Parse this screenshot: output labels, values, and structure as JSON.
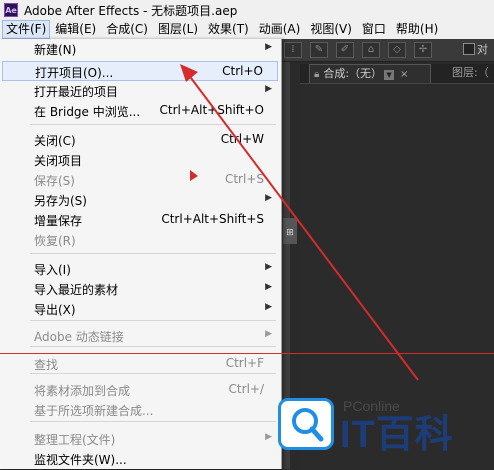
{
  "window": {
    "title": "Adobe After Effects - 无标题项目.aep",
    "logo": "Ae"
  },
  "menubar": [
    {
      "label": "文件(F)",
      "active": true
    },
    {
      "label": "编辑(E)"
    },
    {
      "label": "合成(C)"
    },
    {
      "label": "图层(L)"
    },
    {
      "label": "效果(T)"
    },
    {
      "label": "动画(A)"
    },
    {
      "label": "视图(V)"
    },
    {
      "label": "窗口"
    },
    {
      "label": "帮助(H)"
    }
  ],
  "toolbar": {
    "checkbox_label": "对"
  },
  "composition_panel": {
    "tab_label": "合成:（无）",
    "close": "×",
    "layer_tab": "图层:（"
  },
  "file_menu": {
    "items": [
      {
        "label": "新建(N)",
        "shortcut": "",
        "submenu": true
      },
      {
        "label": "打开项目(O)...",
        "shortcut": "Ctrl+O",
        "highlight": true
      },
      {
        "label": "打开最近的项目",
        "shortcut": "",
        "submenu": true
      },
      {
        "label": "在 Bridge 中浏览...",
        "shortcut": "Ctrl+Alt+Shift+O"
      },
      {
        "label": "关闭(C)",
        "shortcut": "Ctrl+W"
      },
      {
        "label": "关闭项目",
        "shortcut": ""
      },
      {
        "label": "保存(S)",
        "shortcut": "Ctrl+S",
        "disabled": true
      },
      {
        "label": "另存为(S)",
        "shortcut": "",
        "submenu": true
      },
      {
        "label": "增量保存",
        "shortcut": "Ctrl+Alt+Shift+S"
      },
      {
        "label": "恢复(R)",
        "shortcut": "",
        "disabled": true
      },
      {
        "label": "导入(I)",
        "shortcut": "",
        "submenu": true
      },
      {
        "label": "导入最近的素材",
        "shortcut": "",
        "submenu": true
      },
      {
        "label": "导出(X)",
        "shortcut": "",
        "submenu": true
      },
      {
        "label": "Adobe 动态链接",
        "shortcut": "",
        "submenu": true,
        "disabled": true
      },
      {
        "label": "查找",
        "shortcut": "Ctrl+F",
        "disabled": true
      },
      {
        "label": "将素材添加到合成",
        "shortcut": "Ctrl+/",
        "disabled": true
      },
      {
        "label": "基于所选项新建合成...",
        "shortcut": "",
        "disabled": true
      },
      {
        "label": "整理工程(文件)",
        "shortcut": "",
        "submenu": true,
        "disabled": true
      },
      {
        "label": "监视文件夹(W)...",
        "shortcut": ""
      }
    ]
  },
  "watermark": {
    "brand": "PConline",
    "name": "IT百科"
  },
  "colors": {
    "menu_bg": "#f5f5f5",
    "highlight": "#e6eefb",
    "annotation_red": "#d52b2b",
    "dark_bg": "#2a2a2a"
  }
}
